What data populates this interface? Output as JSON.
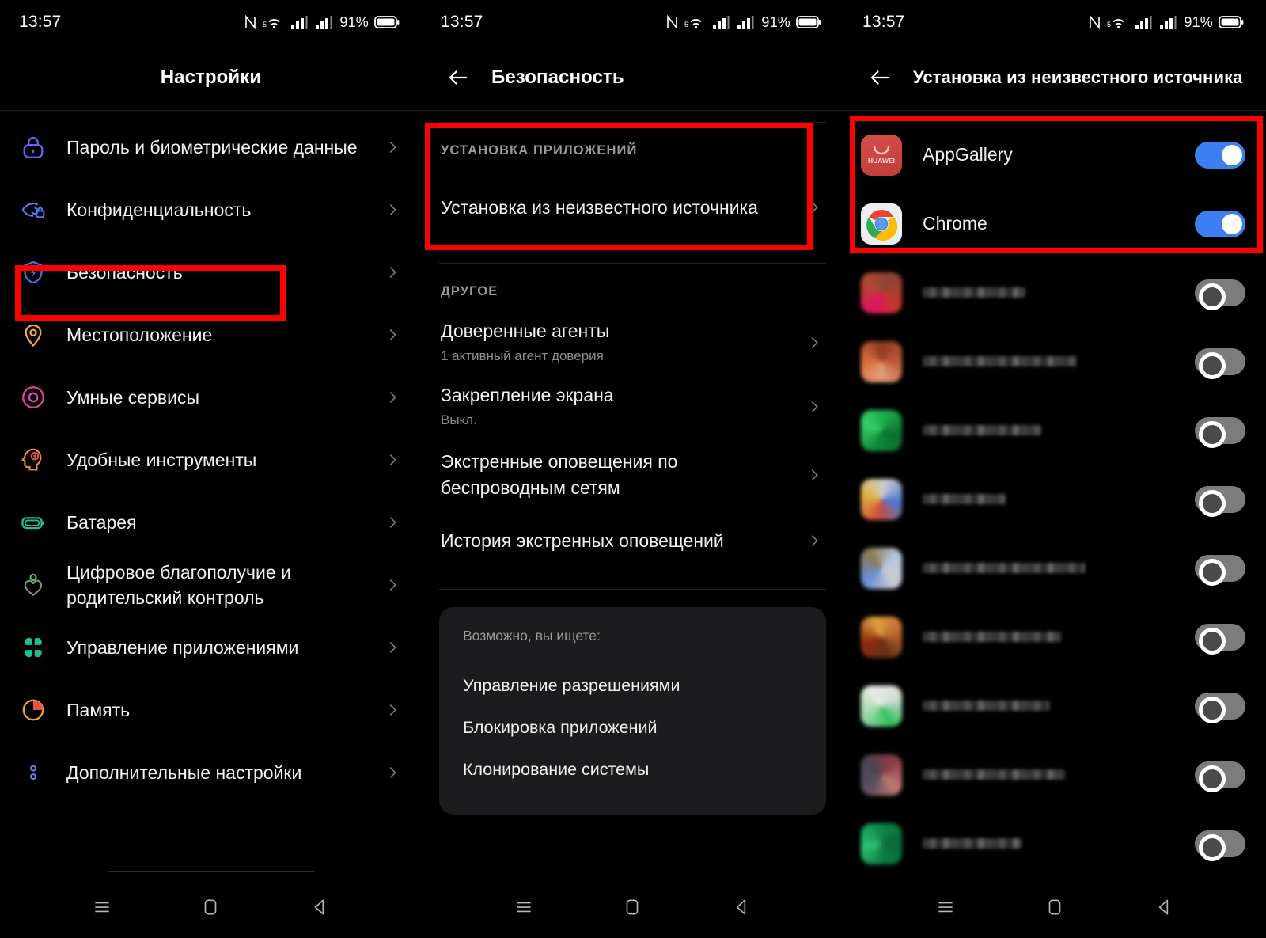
{
  "status_bar": {
    "time": "13:57",
    "battery_pct": "91%",
    "icons": [
      "nfc-icon",
      "wifi-5g-icon",
      "signal-bars-icon",
      "signal-bars-icon",
      "battery-icon"
    ]
  },
  "colors": {
    "toggle_on": "#3b7ff0",
    "toggle_off": "#7c7c7c",
    "highlight": "#fe0000",
    "background": "#000000",
    "card": "#1c1c1e"
  },
  "screen1": {
    "title": "Настройки",
    "highlighted_item_index": 2,
    "items": [
      {
        "label": "Пароль и биометрические данные",
        "icon": "lock-icon",
        "icon_color": "#5b6cf0"
      },
      {
        "label": "Конфиденциальность",
        "icon": "privacy-eye-icon",
        "icon_color": "#4f7ef5"
      },
      {
        "label": "Безопасность",
        "icon": "shield-bolt-icon",
        "icon_color": "#4a6df2"
      },
      {
        "label": "Местоположение",
        "icon": "location-pin-icon",
        "icon_color": "#f0a93c"
      },
      {
        "label": "Умные сервисы",
        "icon": "smart-services-icon",
        "icon_color": "#e0409a"
      },
      {
        "label": "Удобные инструменты",
        "icon": "head-tools-icon",
        "icon_color": "#ef8a3c"
      },
      {
        "label": "Батарея",
        "icon": "battery-icon",
        "icon_color": "#1fbf92"
      },
      {
        "label": "Цифровое благополучие и родительский контроль",
        "icon": "heart-person-icon",
        "icon_color": "#63b86a"
      },
      {
        "label": "Управление приложениями",
        "icon": "apps-grid-icon",
        "icon_color": "#1fbf92"
      },
      {
        "label": "Память",
        "icon": "pie-chart-icon",
        "icon_color": "#e8a62e"
      },
      {
        "label": "Дополнительные настройки",
        "icon": "more-dots-icon",
        "icon_color": "#6c7ae0"
      }
    ]
  },
  "screen2": {
    "title": "Безопасность",
    "back_icon": "back-arrow-icon",
    "section_install": {
      "header": "УСТАНОВКА ПРИЛОЖЕНИЙ",
      "items": [
        {
          "title": "Установка из неизвестного источника",
          "subtitle": ""
        }
      ]
    },
    "section_other": {
      "header": "ДРУГОЕ",
      "items": [
        {
          "title": "Доверенные агенты",
          "subtitle": "1 активный агент доверия"
        },
        {
          "title": "Закрепление экрана",
          "subtitle": "Выкл."
        },
        {
          "title": "Экстренные оповещения по беспроводным сетям",
          "subtitle": ""
        },
        {
          "title": "История экстренных оповещений",
          "subtitle": ""
        }
      ]
    },
    "suggestions": {
      "header": "Возможно, вы ищете:",
      "items": [
        "Управление разрешениями",
        "Блокировка приложений",
        "Клонирование системы"
      ]
    }
  },
  "screen3": {
    "title": "Установка из неизвестного источника",
    "back_icon": "back-arrow-icon",
    "apps": [
      {
        "name": "AppGallery",
        "icon": "appgallery-icon",
        "toggle": "on",
        "blurred": false
      },
      {
        "name": "Chrome",
        "icon": "chrome-icon",
        "toggle": "on",
        "blurred": false
      },
      {
        "name": "",
        "icon": "blurred-app-icon",
        "toggle": "off",
        "blurred": true,
        "icon_colors": [
          "#8a4436",
          "#c0392b",
          "#e0145f",
          "#b0492f"
        ],
        "label_width": 130
      },
      {
        "name": "",
        "icon": "blurred-app-icon",
        "toggle": "off",
        "blurred": true,
        "icon_colors": [
          "#c05a3a",
          "#e0a07a",
          "#d8713f",
          "#8a3a22"
        ],
        "label_width": 195
      },
      {
        "name": "",
        "icon": "blurred-app-icon",
        "toggle": "off",
        "blurred": true,
        "icon_colors": [
          "#0f8a3c",
          "#3ad06a",
          "#19a84c",
          "#0c6e2e"
        ],
        "label_width": 150
      },
      {
        "name": "",
        "icon": "blurred-app-icon",
        "toggle": "off",
        "blurred": true,
        "icon_colors": [
          "#cfcfcf",
          "#4a78d0",
          "#d04a3a",
          "#e0b040"
        ],
        "label_width": 105
      },
      {
        "name": "",
        "icon": "blurred-app-icon",
        "toggle": "off",
        "blurred": true,
        "icon_colors": [
          "#c8ccd0",
          "#6a90d8",
          "#8a7a50",
          "#b8c8e0"
        ],
        "label_width": 205
      },
      {
        "name": "",
        "icon": "blurred-app-icon",
        "toggle": "off",
        "blurred": true,
        "icon_colors": [
          "#8a2a10",
          "#e0a040",
          "#c06a30",
          "#6a3018"
        ],
        "label_width": 175
      },
      {
        "name": "",
        "icon": "blurred-app-icon",
        "toggle": "off",
        "blurred": true,
        "icon_colors": [
          "#d8dcd8",
          "#2fc060",
          "#9ad8a8",
          "#e8ece8"
        ],
        "label_width": 160
      },
      {
        "name": "",
        "icon": "blurred-app-icon",
        "toggle": "off",
        "blurred": true,
        "icon_colors": [
          "#4a4450",
          "#8a3a4a",
          "#c07870",
          "#5a5060"
        ],
        "label_width": 180
      },
      {
        "name": "",
        "icon": "blurred-app-icon",
        "toggle": "off",
        "blurred": true,
        "icon_colors": [
          "#0a7a40",
          "#2fc070",
          "#0d8a4a",
          "#0a6a38"
        ],
        "label_width": 125
      }
    ]
  },
  "nav_bar": {
    "buttons": [
      {
        "name": "recents-button",
        "icon": "menu-lines-icon"
      },
      {
        "name": "home-button",
        "icon": "square-icon"
      },
      {
        "name": "back-button",
        "icon": "triangle-left-icon"
      }
    ]
  }
}
